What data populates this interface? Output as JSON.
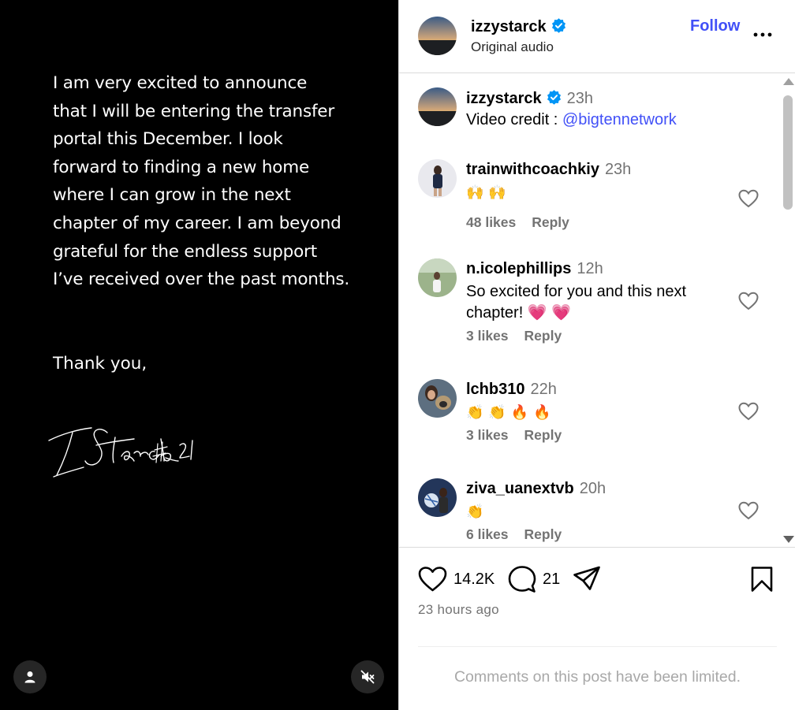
{
  "media": {
    "statement_lines": [
      "I am very excited to announce",
      "that I will be entering the transfer",
      "portal this December. I look",
      "forward to finding a new home",
      "where I can grow in the next",
      "chapter of my career. I am beyond",
      "grateful for the endless support",
      "I’ve received over the past months."
    ],
    "closing": "Thank you,",
    "signature_text": "I Starck #21"
  },
  "post_header": {
    "username": "izzystarck",
    "audio": "Original audio",
    "follow_label": "Follow"
  },
  "caption": {
    "username": "izzystarck",
    "time": "23h",
    "text_prefix": "Video credit : ",
    "mention": "@bigtennetwork"
  },
  "comments": [
    {
      "username": "trainwithcoachkiy",
      "time": "23h",
      "emojis": [
        "🙌",
        "🙌"
      ],
      "text": "",
      "likes": "48 likes",
      "reply": "Reply"
    },
    {
      "username": "n.icolephillips",
      "time": "12h",
      "emojis": [],
      "text": "So excited for you and this next chapter! 💗 💗",
      "likes": "3 likes",
      "reply": "Reply"
    },
    {
      "username": "lchb310",
      "time": "22h",
      "emojis": [
        "👏",
        "👏",
        "🔥",
        "🔥"
      ],
      "text": "",
      "likes": "3 likes",
      "reply": "Reply"
    },
    {
      "username": "ziva_uanextvb",
      "time": "20h",
      "emojis": [
        "👏"
      ],
      "text": "",
      "likes": "6 likes",
      "reply": "Reply"
    }
  ],
  "actions": {
    "likes_count": "14.2K",
    "comments_count": "21",
    "posted_ago": "23 hours ago"
  },
  "footer": {
    "limited_notice": "Comments on this post have been limited."
  },
  "colors": {
    "link_blue": "#4150f7",
    "verified_blue": "#0095f6",
    "muted_text": "#737373"
  }
}
